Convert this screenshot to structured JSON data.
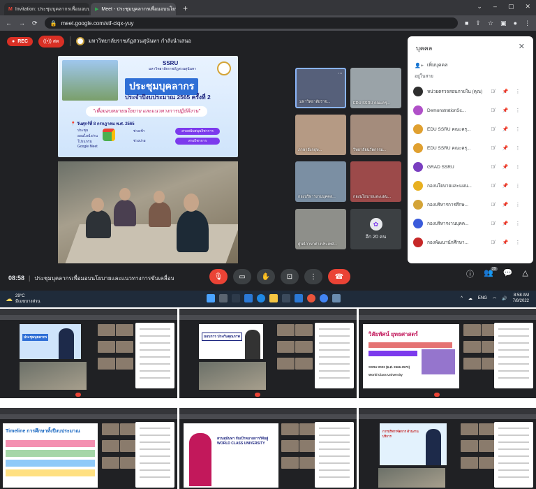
{
  "browser": {
    "tabs": [
      {
        "label": "Invitation: ประชุมบุคลากรเพื่อมอบนโยบาย",
        "icon": "gmail-icon"
      },
      {
        "label": "Meet - ประชุมบุคลากรเพื่อมอบนโยบาย",
        "icon": "meet-icon"
      }
    ],
    "url": "meet.google.com/stf-ciqx-yuy"
  },
  "meet": {
    "rec_label": "REC",
    "live_label": "สด",
    "host_label": "มหาวิทยาลัยราชภัฏสวนสุนันทา กำลังนำเสนอ",
    "time": "08:58",
    "meeting_title": "ประชุมบุคลากรเพื่อมอบนโยบายและแนวทางการขับเคลื่อน...",
    "people_count": "29"
  },
  "slide": {
    "org": "SSRU",
    "university": "มหาวิทยาลัยราชภัฏสวนสุนันทา",
    "title": "ประชุมบุคลากร",
    "subtitle": "ประจำปีงบประมาณ 2565 ครั้งที่ 2",
    "tagline": "\"เพื่อมอบหมายนโยบาย และแนวทางการปฏิบัติงาน\"",
    "date": "วันศุกร์ที่ 8 กรกฎาคม พ.ศ. 2565",
    "via": "ประชุมออนไลน์ ผ่านโปรแกรม Google Meet",
    "agenda": [
      {
        "label": "ช่วงเช้า",
        "button": "สายสนับสนุนวิชาการ"
      },
      {
        "label": "ช่วงบ่าย",
        "button": "สายวิชาการ"
      }
    ]
  },
  "tiles": [
    {
      "label": "มหาวิทยาลัยราช..."
    },
    {
      "label": "EDU SSRU คณะครุ..."
    },
    {
      "label": "ภาษาอังกฤษ..."
    },
    {
      "label": "วิทยาลัยนวัตกรรม..."
    },
    {
      "label": "กองบริหารงานบุคคล..."
    },
    {
      "label": "กองนโยบายและแผน..."
    },
    {
      "label": "ศูนย์ภาษาต่างประเทศ..."
    }
  ],
  "more_tile": {
    "label": "อีก 20 คน"
  },
  "panel": {
    "title": "บุคคล",
    "add_people": "เพิ่มบุคคล",
    "section": "อยู่ในสาย",
    "people": [
      {
        "name": "หน่วยตรวจสอบภายใน (คุณ)",
        "color": "#2e2e2e"
      },
      {
        "name": "DemonstrationSc...",
        "color": "#b050c8"
      },
      {
        "name": "EDU SSRU คณะครุ...",
        "color": "#e0a030"
      },
      {
        "name": "EDU SSRU คณะครุ...",
        "color": "#e0a030"
      },
      {
        "name": "GRAD SSRU",
        "color": "#7a3fc0"
      },
      {
        "name": "กองนโยบายและแผน...",
        "color": "#e8b020"
      },
      {
        "name": "กองบริหารการศึกษ...",
        "color": "#d4a437"
      },
      {
        "name": "กองบริหารงานบุคค...",
        "color": "#3b5bdb"
      },
      {
        "name": "กองพัฒนานักศึกษา...",
        "color": "#c62828"
      }
    ]
  },
  "taskbar": {
    "temp": "29°C",
    "weather": "มีเมฆบางส่วน",
    "lang": "ENG",
    "time": "8:58 AM",
    "date": "7/8/2022"
  },
  "thumbnails": [
    {
      "slide_text": "ประชุมบุคลากร"
    },
    {
      "slide_text": "มอบการ ประกันคุณภาพ"
    },
    {
      "slide_text": "วิสัยทัศน์ ยุทธศาสตร์",
      "extra": "SSRU 2022 (พ.ศ. 2566-2570)",
      "extra2": "World Class University"
    },
    {
      "slide_text": "Timeline การศึกษาทั้งปีงบประมาณ"
    },
    {
      "slide_text": "สวนสุนันทา กับเป้าหมายการวิจัยสู่ WORLD CLASS UNIVERSITY"
    },
    {
      "slide_text": "การบริหารจัดการ ด้านงานบริการ"
    }
  ]
}
